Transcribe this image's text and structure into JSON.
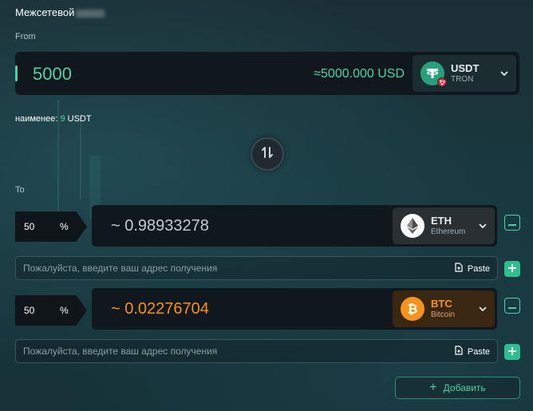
{
  "header": {
    "title": "Межсетевой"
  },
  "from": {
    "label": "From",
    "amount": "5000",
    "usd_approx": "≈5000.000 USD",
    "token": {
      "symbol": "USDT",
      "network": "TRON",
      "icon": "usdt-tron-icon",
      "color": "#26a17b"
    }
  },
  "minimum": {
    "label": "наименее:",
    "value": "9",
    "unit": "USDT"
  },
  "swap": {
    "icon": "swap-arrows-icon"
  },
  "to": {
    "label": "To",
    "rows": [
      {
        "percent": "50",
        "percent_sign": "%",
        "amount": "~ 0.98933278",
        "amount_color": "#c3ccd0",
        "token": {
          "symbol": "ETH",
          "network": "Ethereum",
          "icon": "ethereum-icon"
        },
        "address_placeholder": "Пожалуйста, введите ваш адрес получения",
        "paste_label": "Paste"
      },
      {
        "percent": "50",
        "percent_sign": "%",
        "amount": "~ 0.02276704",
        "amount_color": "#f7931a",
        "token": {
          "symbol": "BTC",
          "network": "Bitcoin",
          "icon": "bitcoin-icon"
        },
        "address_placeholder": "Пожалуйста, введите ваш адрес получения",
        "paste_label": "Paste"
      }
    ]
  },
  "add_button": {
    "label": "Добавить"
  },
  "colors": {
    "accent": "#4fd1a5",
    "btc": "#f7931a",
    "usdt": "#26a17b",
    "tron_badge": "#e0283c"
  }
}
